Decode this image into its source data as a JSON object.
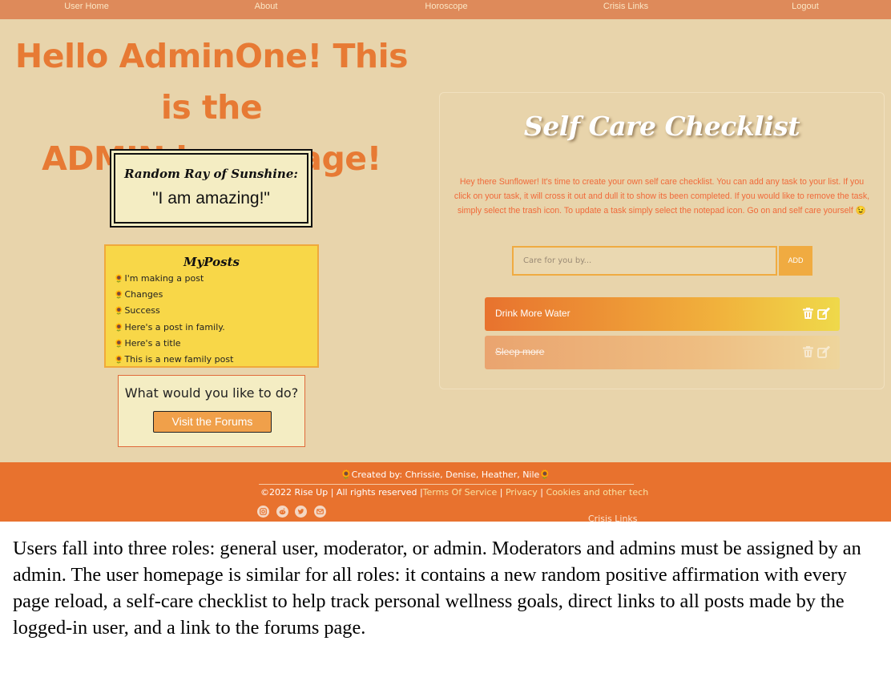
{
  "nav": {
    "items": [
      {
        "label": "User Home"
      },
      {
        "label": "About"
      },
      {
        "label": "Horoscope"
      },
      {
        "label": "Crisis Links"
      },
      {
        "label": "Logout"
      }
    ]
  },
  "greeting": {
    "line1": "Hello AdminOne! This is the",
    "line2": "ADMIN homepage!"
  },
  "sunshine": {
    "title": "Random Ray of Sunshine:",
    "quote": "\"I am amazing!\""
  },
  "posts": {
    "title": "MyPosts",
    "icon": "sunflower-icon",
    "items": [
      "I'm making a post",
      "Changes",
      "Success",
      "Here's a post in family.",
      "Here's a title",
      "This is a new family post"
    ]
  },
  "actions": {
    "question": "What would you like to do?",
    "forums_button": "Visit the Forums"
  },
  "checklist": {
    "title": "Self Care Checklist",
    "description": "Hey there Sunflower! It's time to create your own self care checklist. You can add any task to your list. If you click on your task, it will cross it out and dull it to show its been completed. If you would like to remove the task, simply select the trash icon. To update a task simply select the notepad icon. Go on and self care yourself 😉",
    "input_placeholder": "Care for you by...",
    "add_button": "ADD",
    "tasks": [
      {
        "label": "Drink More Water",
        "completed": false
      },
      {
        "label": "Sleep more",
        "completed": true
      }
    ]
  },
  "footer": {
    "credit": "🌻Created by: Chrissie, Denise, Heather, Nile🌻",
    "copyright": "©2022 Rise Up | All rights reserved |",
    "links": [
      "Terms Of Service",
      "Privacy",
      "Cookies and other tech"
    ],
    "separator": "|",
    "social_icons": [
      "instagram-icon",
      "reddit-icon",
      "twitter-icon",
      "mail-icon"
    ],
    "crisis_links": "Crisis Links"
  },
  "caption": "Users fall into three roles: general user, moderator, or admin. Moderators and admins must be assigned by an admin. The user homepage is similar for all roles: it contains a new random positive affirmation with every page reload, a self-care checklist to help track personal wellness goals, direct links to all posts made by the logged-in user, and a link to the forums page.",
  "colors": {
    "background": "#e8d4ab",
    "nav": "#de8a5a",
    "accent": "#e77a34",
    "footer": "#e8722e",
    "posts_bg": "#f8d748"
  }
}
